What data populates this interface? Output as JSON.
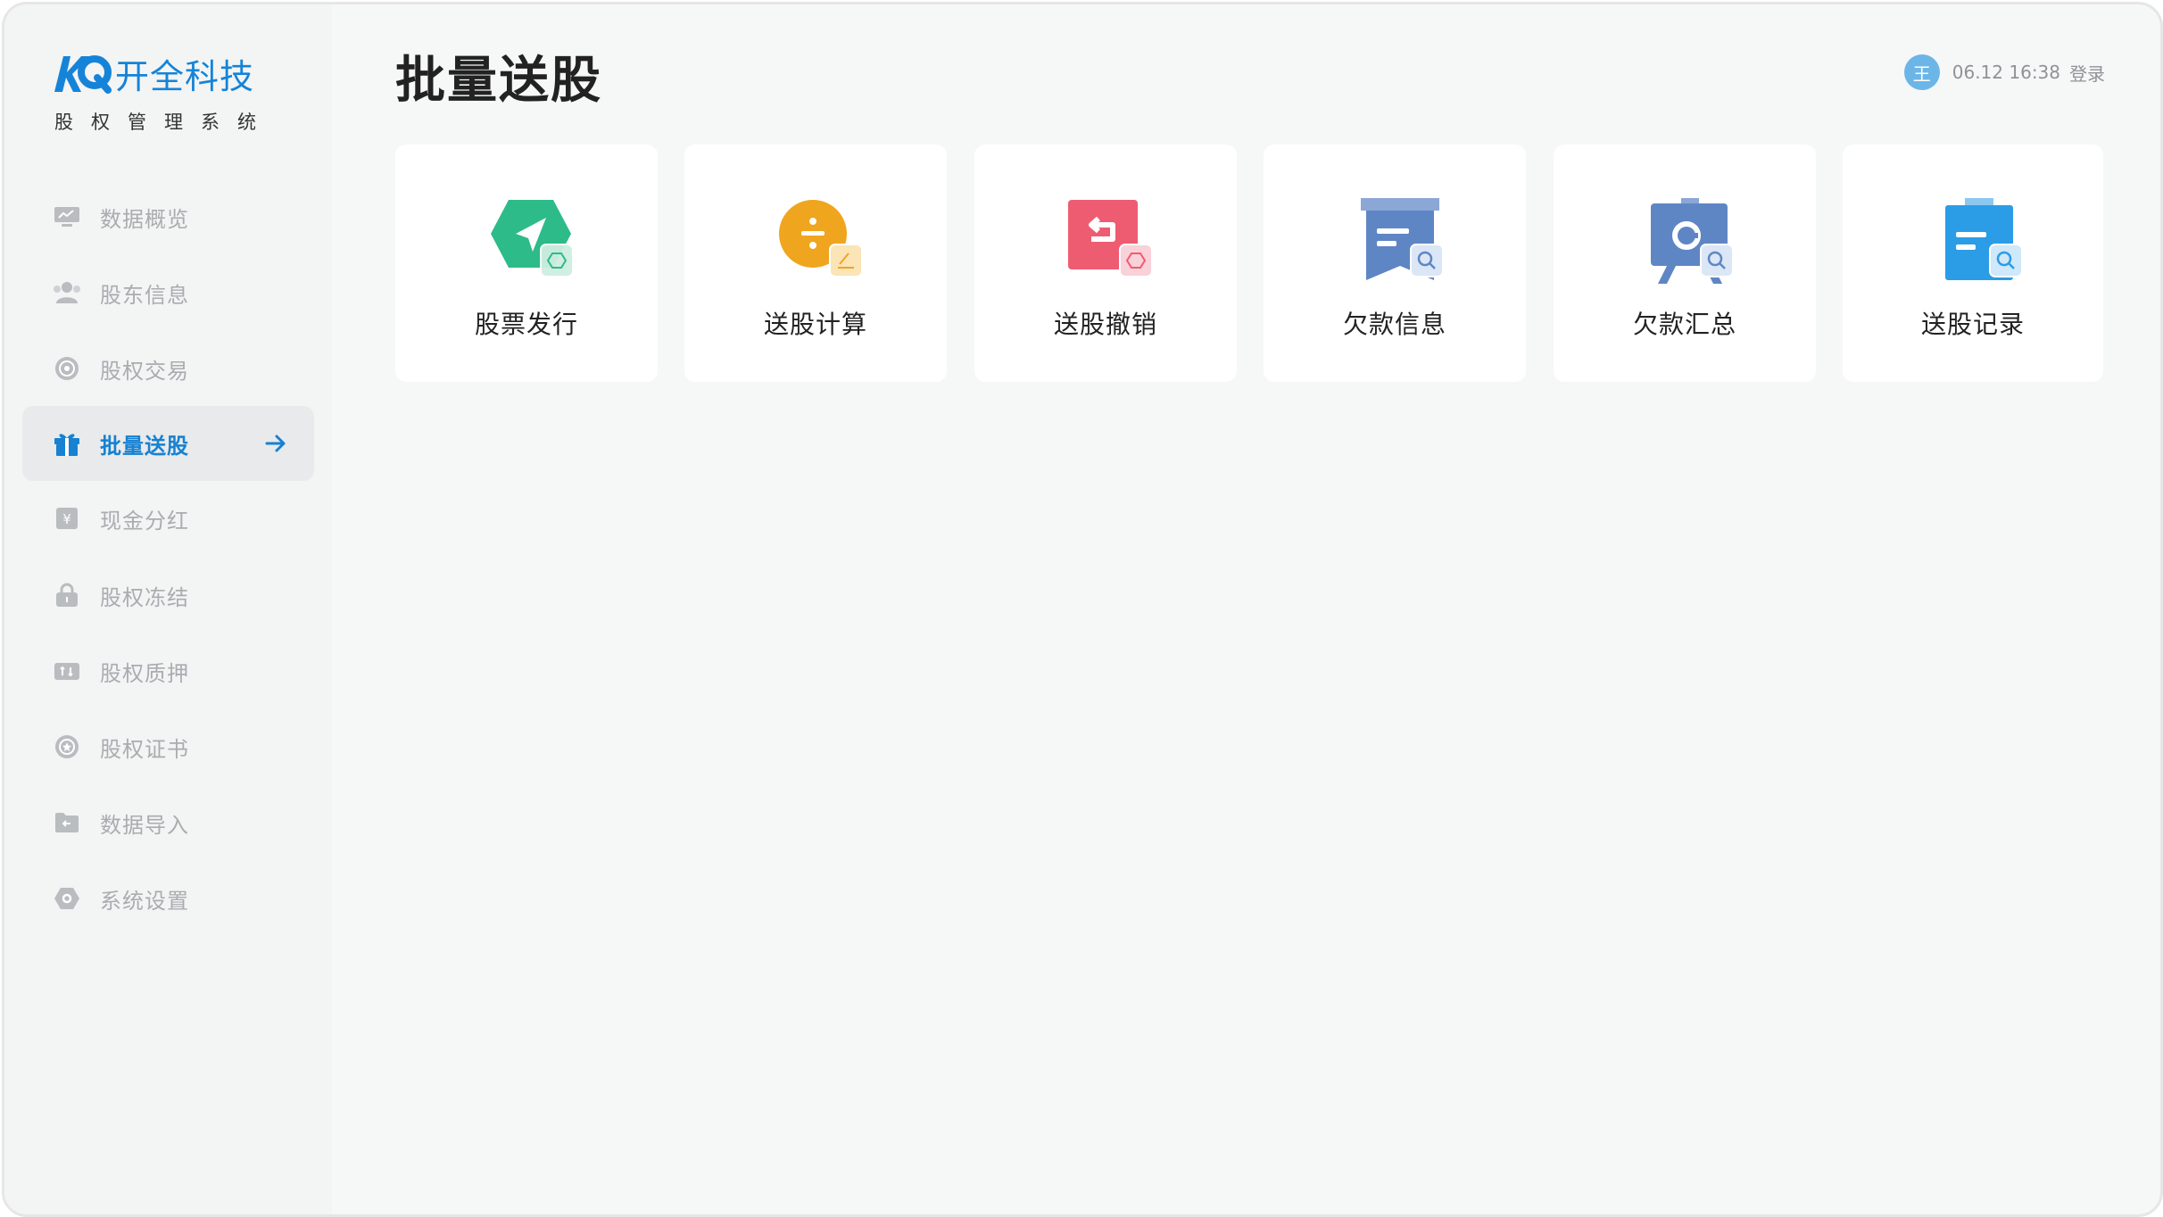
{
  "brand": {
    "name": "开全科技",
    "subtitle": "股权管理系统",
    "logo_icon": "kq-logo"
  },
  "page": {
    "title": "批量送股"
  },
  "user": {
    "avatar_text": "王",
    "time": "06.12 16:38",
    "login": "登录"
  },
  "sidebar": {
    "active_index": 3,
    "items": [
      {
        "label": "数据概览",
        "icon": "monitor-icon"
      },
      {
        "label": "股东信息",
        "icon": "users-icon"
      },
      {
        "label": "股权交易",
        "icon": "exchange-icon"
      },
      {
        "label": "批量送股",
        "icon": "gift-icon"
      },
      {
        "label": "现金分红",
        "icon": "yen-icon"
      },
      {
        "label": "股权冻结",
        "icon": "lock-icon"
      },
      {
        "label": "股权质押",
        "icon": "pledge-icon"
      },
      {
        "label": "股权证书",
        "icon": "certificate-icon"
      },
      {
        "label": "数据导入",
        "icon": "folder-import-icon"
      },
      {
        "label": "系统设置",
        "icon": "settings-icon"
      }
    ]
  },
  "cards": [
    {
      "label": "股票发行",
      "icon": "issue-icon",
      "color": "#2dbb8a"
    },
    {
      "label": "送股计算",
      "icon": "divide-icon",
      "color": "#f0a51f"
    },
    {
      "label": "送股撤销",
      "icon": "undo-icon",
      "color": "#ee5c72"
    },
    {
      "label": "欠款信息",
      "icon": "debt-info-icon",
      "color": "#5f86c4"
    },
    {
      "label": "欠款汇总",
      "icon": "debt-summary-icon",
      "color": "#5f86c4"
    },
    {
      "label": "送股记录",
      "icon": "record-icon",
      "color": "#2a9de6"
    }
  ],
  "colors": {
    "accent": "#1781d2",
    "inactive_text": "#a9adb0"
  }
}
